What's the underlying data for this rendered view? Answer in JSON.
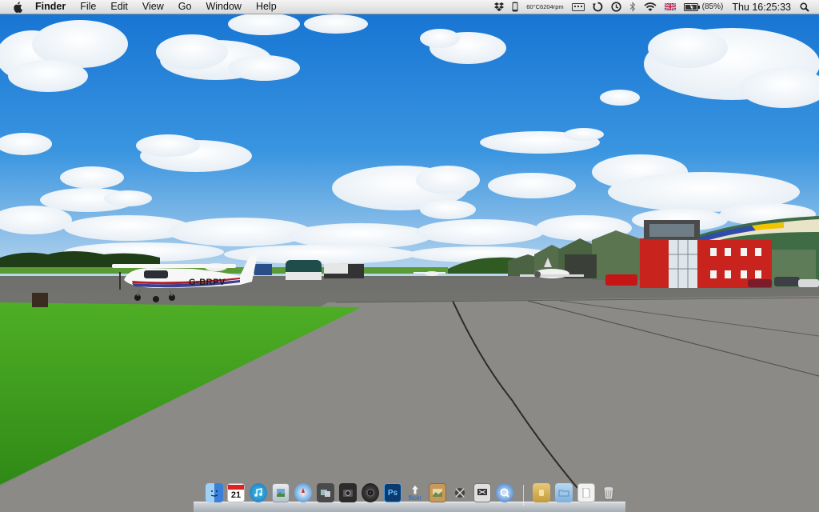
{
  "menubar": {
    "apple_icon": "apple-logo-icon",
    "app_name": "Finder",
    "menus": [
      "File",
      "Edit",
      "View",
      "Go",
      "Window",
      "Help"
    ],
    "status": {
      "cpu_temp": "60°C",
      "fan_speed": "6204rpm",
      "battery_percent": "(85%)",
      "clock": "Thu 16:25:33",
      "icons": [
        "dropbox-icon",
        "phone-icon",
        "keyboard-icon",
        "sync-icon",
        "time-machine-icon",
        "bluetooth-icon",
        "wifi-icon",
        "uk-flag-icon",
        "battery-icon",
        "spotlight-icon"
      ]
    }
  },
  "wallpaper": {
    "aircraft_registration": "G-BRPV"
  },
  "dock": {
    "calendar_day": "21",
    "photoshop_label": "Ps",
    "flickr_label": "flickr",
    "icons": [
      "finder-icon",
      "ical-icon",
      "itunes-icon",
      "preview-icon",
      "safari-icon",
      "migration-icon",
      "iphoto-icon",
      "speaker-icon",
      "photoshop-icon",
      "flickr-uploader-icon",
      "image-capture-icon",
      "dashboard-icon",
      "screen-sharing-icon",
      "quicktime-icon",
      "applications-folder-icon",
      "documents-folder-icon",
      "downloads-icon",
      "trash-icon"
    ]
  },
  "colors": {
    "sky_top": "#1e82dc",
    "sky_bottom": "#9cc8ee",
    "grass": "#3e9a1e",
    "tarmac": "#807f7c",
    "building_red": "#c8231c",
    "hangar_green": "#4f6a45"
  }
}
